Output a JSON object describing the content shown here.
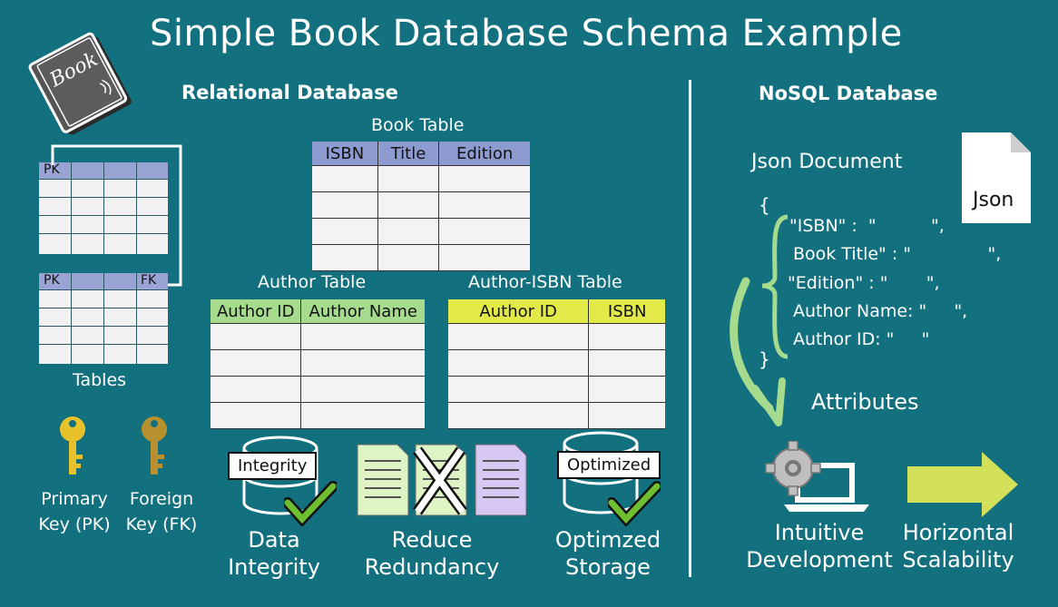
{
  "title": "Simple Book Database Schema Example",
  "book_icon_text": "Book",
  "relational": {
    "heading": "Relational Database",
    "tables_caption": "Tables",
    "mini_table_1_tag": "PK",
    "mini_table_2_tags": [
      "PK",
      "FK"
    ],
    "book_table": {
      "caption": "Book Table",
      "columns": [
        "ISBN",
        "Title",
        "Edition"
      ]
    },
    "author_table": {
      "caption": "Author Table",
      "columns": [
        "Author ID",
        "Author Name"
      ]
    },
    "author_isbn_table": {
      "caption": "Author-ISBN Table",
      "columns": [
        "Author ID",
        "ISBN"
      ]
    },
    "keys": {
      "primary": [
        "Primary",
        "Key (PK)"
      ],
      "foreign": [
        "Foreign",
        "Key (FK)"
      ]
    },
    "benefits": [
      {
        "badge": "Integrity",
        "caption": [
          "Data",
          "Integrity"
        ]
      },
      {
        "caption": [
          "Reduce",
          "Redundancy"
        ]
      },
      {
        "badge": "Optimized",
        "caption": [
          "Optimzed",
          "Storage"
        ]
      }
    ]
  },
  "nosql": {
    "heading": "NoSQL Database",
    "json_caption": "Json Document",
    "file_label": "Json",
    "open_brace": "{",
    "close_brace": "}",
    "lines": [
      "\"ISBN\" :  \"          \",",
      "Book Title\" : \"              \",",
      "\"Edition\" : \"       \",",
      "Author Name: \"     \",",
      "Author ID: \"     \""
    ],
    "attributes_label": "Attributes",
    "benefits": [
      {
        "caption": [
          "Intuitive",
          "Development"
        ]
      },
      {
        "caption": [
          "Horizontal",
          "Scalability"
        ]
      }
    ]
  },
  "colors": {
    "background": "#12707f",
    "book_header": "#8e9bd1",
    "author_header": "#a6db8e",
    "author_isbn_header": "#e2ea4a",
    "primary_key": "#e8c22a",
    "foreign_key": "#b8912e",
    "check": "#6fbe2f",
    "arrow": "#d2e05a"
  }
}
